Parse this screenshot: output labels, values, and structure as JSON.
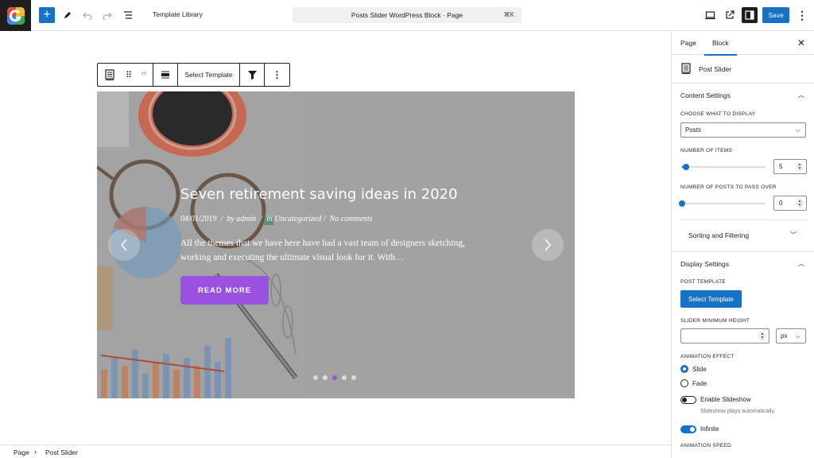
{
  "topbar": {
    "template_library": "Template Library",
    "command_title": "Posts Slider WordPress Block · Page",
    "command_shortcut": "⌘K",
    "save_label": "Save"
  },
  "block_toolbar": {
    "select_template": "Select Template"
  },
  "slide": {
    "title": "Seven retirement saving ideas in 2020",
    "date": "04/01/2019",
    "by": "by",
    "author": "admin",
    "in": "in",
    "category": "Uncategorized",
    "comments": "No comments",
    "excerpt": "All the themes that we have here have had a vast team of designers sketching, working and executing the ultimate visual look for it. With…",
    "read_more": "READ MORE",
    "dot_count": 5,
    "active_dot": 2
  },
  "breadcrumb": {
    "page": "Page",
    "block": "Post Slider"
  },
  "sidebar": {
    "tabs": {
      "page": "Page",
      "block": "Block"
    },
    "block_name": "Post Slider",
    "content_settings": {
      "title": "Content Settings",
      "choose_label": "CHOOSE WHAT TO DISPLAY",
      "choose_value": "Posts",
      "items_label": "NUMBER OF ITEMS",
      "items_value": "5",
      "items_level": 0.05,
      "pass_label": "NUMBER OF POSTS TO PASS OVER",
      "pass_value": "0",
      "pass_level": 0,
      "sorting": "Sorting and Filtering"
    },
    "display_settings": {
      "title": "Display Settings",
      "template_label": "POST TEMPLATE",
      "template_button": "Select Template",
      "height_label": "SLIDER MINIMUM HEIGHT",
      "height_unit": "px",
      "effect_label": "ANIMATION EFFECT",
      "effect_slide": "Slide",
      "effect_fade": "Fade",
      "slideshow_label": "Enable Slideshow",
      "slideshow_help": "Slideshow plays automatically.",
      "infinite_label": "Infinite",
      "speed_label": "ANIMATION SPEED"
    }
  },
  "colors": {
    "accent": "#1672c6",
    "button_purple": "#9b51e0"
  }
}
